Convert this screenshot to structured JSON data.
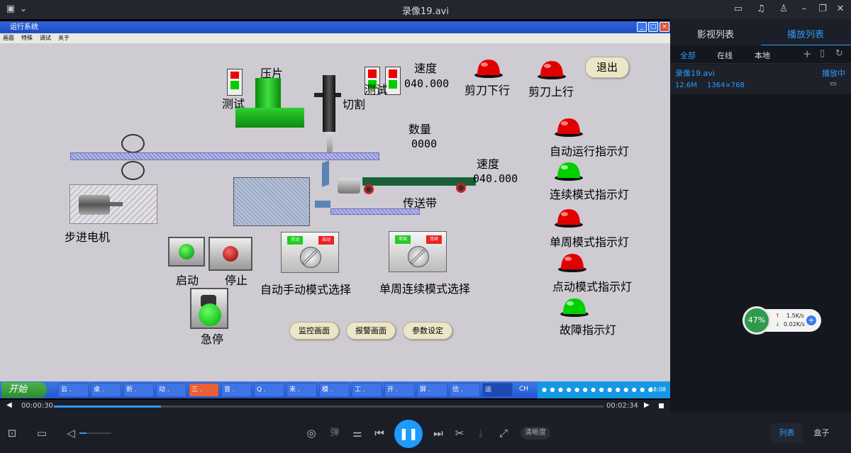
{
  "player": {
    "title": "录像19.avi"
  },
  "hmi_window": {
    "title": "运行系统",
    "menu": [
      "画面",
      "特殊",
      "调试",
      "关于"
    ]
  },
  "hmi": {
    "press_label": "压片",
    "test_label": "测试",
    "cut_label": "切割",
    "test_label2": "测试",
    "speed_label": "速度",
    "speed_value": "040.000",
    "shear_down": "剪刀下行",
    "shear_up": "剪刀上行",
    "exit_label": "退出",
    "count_label": "数量",
    "count_value": "0000",
    "speed_label2": "速度",
    "speed_value2": "040.000",
    "conveyor_label": "传送带",
    "motor_label": "步进电机",
    "start_label": "启动",
    "stop_label": "停止",
    "estop_label": "急停",
    "auto_manual_label": "自动手动模式选择",
    "single_cont_label": "单周连续模式选择",
    "knob1_left": "手动",
    "knob1_right": "自动",
    "knob2_left": "单周",
    "knob2_right": "连续",
    "indicators": [
      {
        "label": "自动运行指示灯",
        "color": "#e00000"
      },
      {
        "label": "连续模式指示灯",
        "color": "#00d000"
      },
      {
        "label": "单周模式指示灯",
        "color": "#e00000"
      },
      {
        "label": "点动模式指示灯",
        "color": "#e00000"
      },
      {
        "label": "故障指示灯",
        "color": "#00d000"
      }
    ],
    "nav": [
      "监控画面",
      "报警画面",
      "参数设定"
    ]
  },
  "taskbar": {
    "start": "开始",
    "tasks": [
      "云 .",
      "桌 .",
      "新 .",
      "动 .",
      "三 .",
      "音 .",
      "Q .",
      "来 .",
      "模 .",
      "工 .",
      "开 .",
      "屏 .",
      "信 .",
      "运"
    ],
    "ime": "CH",
    "clock": "18:08"
  },
  "side": {
    "tabs": [
      "影视列表",
      "播放列表"
    ],
    "subtabs": [
      "全部",
      "在线",
      "本地"
    ],
    "item": {
      "name": "录像19.avi",
      "status": "播放中",
      "size": "12.6M",
      "resolution": "1364×768"
    }
  },
  "net": {
    "percent": "47%",
    "up": "1.5K/s",
    "down": "0.02K/s"
  },
  "seek": {
    "elapsed": "00:00:30",
    "total": "00:02:34",
    "progress": 0.195
  },
  "controls": {
    "danmu": "弹",
    "quality": "清晰度",
    "list": "列表",
    "box": "盒子"
  }
}
